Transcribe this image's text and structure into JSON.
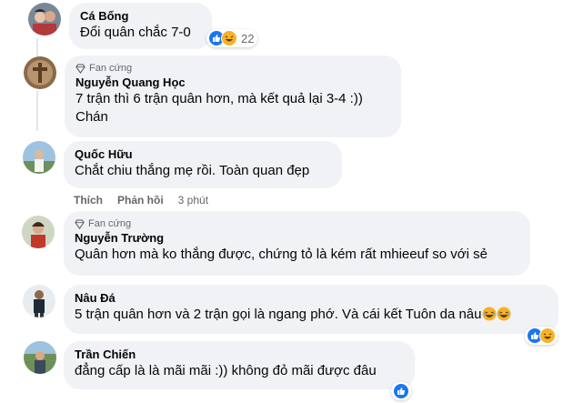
{
  "comments": [
    {
      "author": "Cá Bống",
      "text": "Đổi quân chắc 7-0",
      "reaction_count": "22"
    },
    {
      "badge": "Fan cứng",
      "author": "Nguyễn Quang Học",
      "text_line1": "7 trận thì 6 trận quân hơn, mà kết quả lại 3-4 :))",
      "text_line2": "Chán"
    },
    {
      "author": "Quốc Hữu",
      "text": "Chắt chiu thắng mẹ rồi. Toàn quan đẹp",
      "actions": {
        "like": "Thích",
        "reply": "Phản hồi",
        "time": "3 phút"
      }
    },
    {
      "badge": "Fan cứng",
      "author": "Nguyễn Trường",
      "text": "Quân hơn mà ko thắng được, chứng tỏ là kém rất mhieeuf so với sẻ"
    },
    {
      "author": "Nâu Đá",
      "text": "5 trận quân hơn và 2 trận gọi là ngang phớ. Và cái kết Tuôn da nâu"
    },
    {
      "author": "Trần Chiến",
      "text": "đẳng cấp là là mãi mãi :)) không đỏ mãi được đâu"
    }
  ],
  "colors": {
    "bubble": "#f0f2f5",
    "like": "#1877f2",
    "haha": "#f7b125",
    "meta": "#65676b"
  },
  "icons": {
    "like": "thumbs-up-icon",
    "haha": "laughing-face-icon",
    "badge": "diamond-icon"
  }
}
